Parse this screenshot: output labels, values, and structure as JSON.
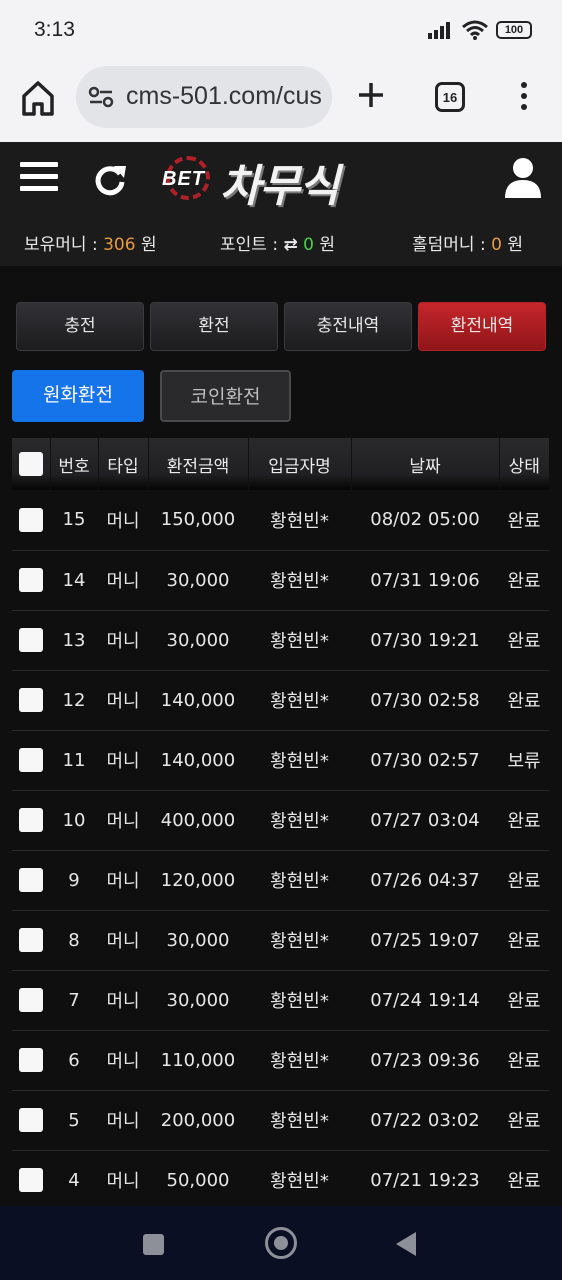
{
  "status_bar": {
    "time": "3:13",
    "battery": "100"
  },
  "browser": {
    "url": "cms-501.com/cus",
    "tab_count": "16"
  },
  "site": {
    "logo_prefix": "BET",
    "logo_text": "차무식"
  },
  "balance": {
    "money_label": "보유머니 : ",
    "money_value": "306",
    "money_unit": " 원",
    "point_label": "포인트 : ",
    "point_icon": "⇄",
    "point_value": "0",
    "point_unit": " 원",
    "holding_label": "홀덤머니 : ",
    "holding_value": "0",
    "holding_unit": " 원"
  },
  "tabs": [
    {
      "label": "충전",
      "active": false
    },
    {
      "label": "환전",
      "active": false
    },
    {
      "label": "충전내역",
      "active": false
    },
    {
      "label": "환전내역",
      "active": true
    }
  ],
  "subtabs": {
    "won": "원화환전",
    "coin": "코인환전"
  },
  "table": {
    "headers": [
      "번호",
      "타입",
      "환전금액",
      "입금자명",
      "날짜",
      "상태"
    ],
    "rows": [
      {
        "no": "15",
        "type": "머니",
        "amount": "150,000",
        "name": "황현빈*",
        "date": "08/02 05:00",
        "status": "완료"
      },
      {
        "no": "14",
        "type": "머니",
        "amount": "30,000",
        "name": "황현빈*",
        "date": "07/31 19:06",
        "status": "완료"
      },
      {
        "no": "13",
        "type": "머니",
        "amount": "30,000",
        "name": "황현빈*",
        "date": "07/30 19:21",
        "status": "완료"
      },
      {
        "no": "12",
        "type": "머니",
        "amount": "140,000",
        "name": "황현빈*",
        "date": "07/30 02:58",
        "status": "완료"
      },
      {
        "no": "11",
        "type": "머니",
        "amount": "140,000",
        "name": "황현빈*",
        "date": "07/30 02:57",
        "status": "보류"
      },
      {
        "no": "10",
        "type": "머니",
        "amount": "400,000",
        "name": "황현빈*",
        "date": "07/27 03:04",
        "status": "완료"
      },
      {
        "no": "9",
        "type": "머니",
        "amount": "120,000",
        "name": "황현빈*",
        "date": "07/26 04:37",
        "status": "완료"
      },
      {
        "no": "8",
        "type": "머니",
        "amount": "30,000",
        "name": "황현빈*",
        "date": "07/25 19:07",
        "status": "완료"
      },
      {
        "no": "7",
        "type": "머니",
        "amount": "30,000",
        "name": "황현빈*",
        "date": "07/24 19:14",
        "status": "완료"
      },
      {
        "no": "6",
        "type": "머니",
        "amount": "110,000",
        "name": "황현빈*",
        "date": "07/23 09:36",
        "status": "완료"
      },
      {
        "no": "5",
        "type": "머니",
        "amount": "200,000",
        "name": "황현빈*",
        "date": "07/22 03:02",
        "status": "완료"
      },
      {
        "no": "4",
        "type": "머니",
        "amount": "50,000",
        "name": "황현빈*",
        "date": "07/21 19:23",
        "status": "완료"
      }
    ]
  },
  "colors": {
    "accent_red": "#c6262b",
    "accent_blue": "#1674ea",
    "value_orange": "#e89a3c",
    "value_green": "#4bd04b"
  }
}
